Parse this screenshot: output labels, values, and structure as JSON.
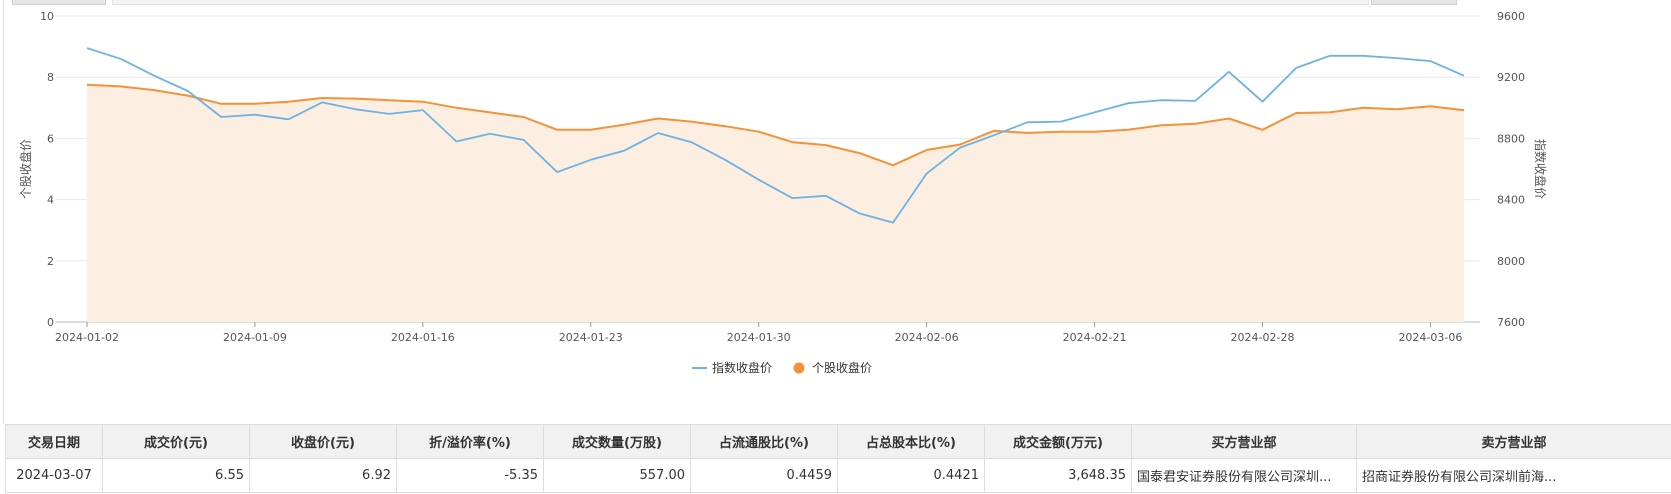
{
  "chart_data": {
    "type": "line",
    "x": [
      "2024-01-02",
      "2024-01-03",
      "2024-01-04",
      "2024-01-05",
      "2024-01-08",
      "2024-01-09",
      "2024-01-10",
      "2024-01-11",
      "2024-01-12",
      "2024-01-15",
      "2024-01-16",
      "2024-01-17",
      "2024-01-18",
      "2024-01-19",
      "2024-01-22",
      "2024-01-23",
      "2024-01-24",
      "2024-01-25",
      "2024-01-26",
      "2024-01-29",
      "2024-01-30",
      "2024-01-31",
      "2024-02-01",
      "2024-02-02",
      "2024-02-05",
      "2024-02-06",
      "2024-02-07",
      "2024-02-08",
      "2024-02-19",
      "2024-02-20",
      "2024-02-21",
      "2024-02-22",
      "2024-02-23",
      "2024-02-26",
      "2024-02-27",
      "2024-02-28",
      "2024-02-29",
      "2024-03-01",
      "2024-03-04",
      "2024-03-05",
      "2024-03-06",
      "2024-03-07"
    ],
    "x_tick_labels": [
      "2024-01-02",
      "2024-01-09",
      "2024-01-16",
      "2024-01-23",
      "2024-01-30",
      "2024-02-06",
      "2024-02-21",
      "2024-02-28",
      "2024-03-06"
    ],
    "x_tick_indices": [
      0,
      5,
      10,
      15,
      20,
      25,
      30,
      35,
      40
    ],
    "series": [
      {
        "name": "指数收盘价",
        "axis": "right",
        "color": "#6cb3e3",
        "values": [
          9390,
          9320,
          9210,
          9110,
          8940,
          8955,
          8925,
          9035,
          8990,
          8960,
          8985,
          8780,
          8830,
          8790,
          8580,
          8660,
          8720,
          8835,
          8775,
          8660,
          8530,
          8410,
          8425,
          8310,
          8250,
          8570,
          8740,
          8820,
          8905,
          8910,
          8970,
          9030,
          9050,
          9045,
          9235,
          9040,
          9260,
          9340,
          9340,
          9325,
          9305,
          9210
        ]
      },
      {
        "name": "个股收盘价",
        "axis": "left",
        "color": "#f39236",
        "fill": "#fdeee2",
        "values": [
          7.75,
          7.7,
          7.58,
          7.4,
          7.13,
          7.13,
          7.2,
          7.32,
          7.3,
          7.25,
          7.2,
          7.0,
          6.85,
          6.7,
          6.28,
          6.28,
          6.45,
          6.65,
          6.55,
          6.4,
          6.22,
          5.88,
          5.78,
          5.52,
          5.12,
          5.62,
          5.8,
          6.25,
          6.18,
          6.22,
          6.22,
          6.28,
          6.43,
          6.48,
          6.65,
          6.28,
          6.83,
          6.85,
          7.0,
          6.95,
          7.05,
          6.92
        ]
      }
    ],
    "y_left": {
      "label": "个股收盘价",
      "ylim": [
        0,
        10
      ],
      "ticks": [
        "0",
        "2",
        "4",
        "6",
        "8",
        "10"
      ]
    },
    "y_right": {
      "label": "指数收盘价",
      "ylim": [
        7600,
        9600
      ],
      "ticks": [
        "7600",
        "8000",
        "8400",
        "8800",
        "9200",
        "9600"
      ]
    },
    "grid": true,
    "legend": "bottom-center"
  },
  "table": {
    "headers": [
      "交易日期",
      "成交价(元)",
      "收盘价(元)",
      "折/溢价率(%)",
      "成交数量(万股)",
      "占流通股比(%)",
      "占总股本比(%)",
      "成交金额(万元)",
      "买方营业部",
      "卖方营业部"
    ],
    "rows": [
      [
        "2024-03-07",
        "6.55",
        "6.92",
        "-5.35",
        "557.00",
        "0.4459",
        "0.4421",
        "3,648.35",
        "国泰君安证券股份有限公司深圳...",
        "招商证券股份有限公司深圳前海..."
      ]
    ]
  }
}
